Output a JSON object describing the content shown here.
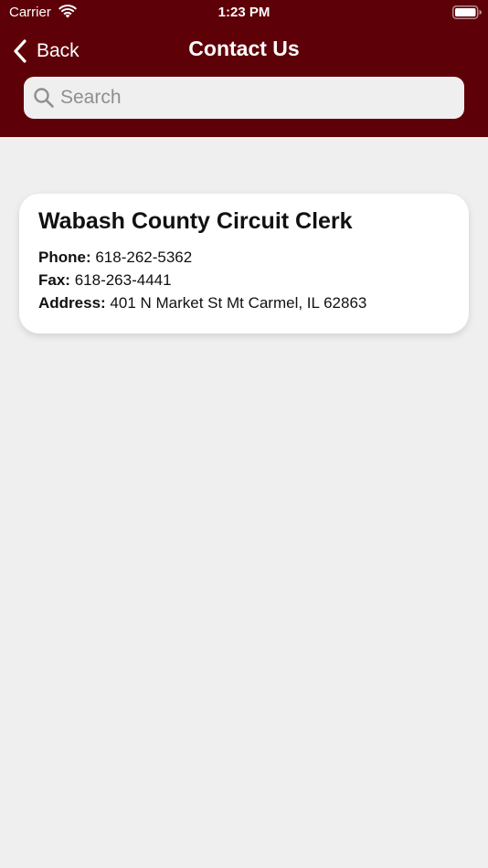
{
  "status_bar": {
    "carrier": "Carrier",
    "time": "1:23 PM",
    "wifi_icon": "wifi-icon",
    "battery_icon": "battery-icon"
  },
  "nav": {
    "back_label": "Back",
    "back_icon": "chevron-left-icon",
    "title": "Contact Us"
  },
  "search": {
    "placeholder": "Search",
    "value": "",
    "icon": "search-icon"
  },
  "contact": {
    "name": "Wabash County Circuit Clerk",
    "phone_label": "Phone:",
    "phone": "618-262-5362",
    "fax_label": "Fax:",
    "fax": "618-263-4441",
    "address_label": "Address:",
    "address": "401 N Market St Mt Carmel, IL 62863"
  },
  "colors": {
    "header_background": "#5e0008",
    "page_background": "#efefef",
    "card_background": "#ffffff",
    "search_background": "#efefef",
    "placeholder_text": "#8e8e93"
  }
}
